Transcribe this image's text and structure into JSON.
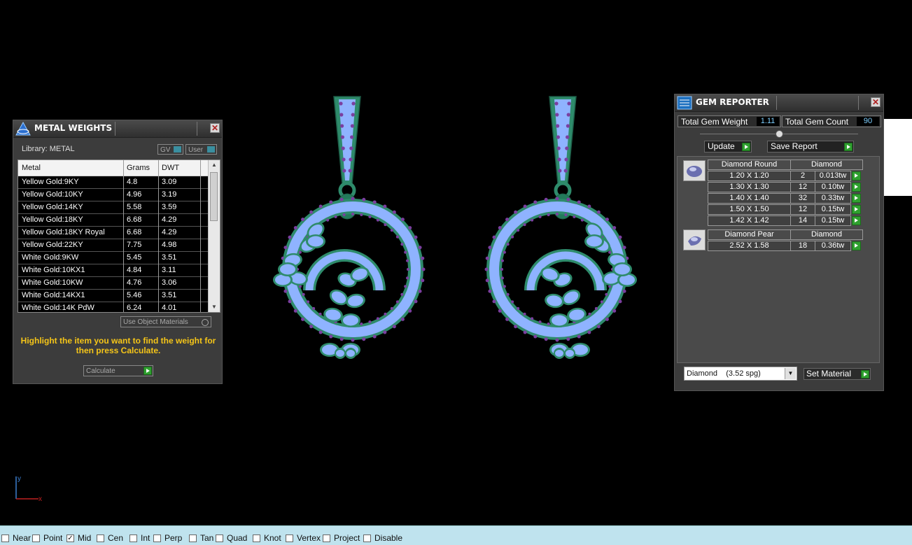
{
  "metal_weights": {
    "title": "METAL WEIGHTS",
    "library_label": "Library: METAL",
    "btn_gv": "GV",
    "btn_user": "User",
    "columns": [
      "Metal",
      "Grams",
      "DWT"
    ],
    "rows": [
      {
        "metal": "Yellow Gold:9KY",
        "grams": "4.8",
        "dwt": "3.09"
      },
      {
        "metal": "Yellow Gold:10KY",
        "grams": "4.96",
        "dwt": "3.19"
      },
      {
        "metal": "Yellow Gold:14KY",
        "grams": "5.58",
        "dwt": "3.59"
      },
      {
        "metal": "Yellow Gold:18KY",
        "grams": "6.68",
        "dwt": "4.29"
      },
      {
        "metal": "Yellow Gold:18KY Royal",
        "grams": "6.68",
        "dwt": "4.29"
      },
      {
        "metal": "Yellow Gold:22KY",
        "grams": "7.75",
        "dwt": "4.98"
      },
      {
        "metal": "White Gold:9KW",
        "grams": "5.45",
        "dwt": "3.51"
      },
      {
        "metal": "White Gold:10KX1",
        "grams": "4.84",
        "dwt": "3.11"
      },
      {
        "metal": "White Gold:10KW",
        "grams": "4.76",
        "dwt": "3.06"
      },
      {
        "metal": "White Gold:14KX1",
        "grams": "5.46",
        "dwt": "3.51"
      },
      {
        "metal": "White Gold:14K PdW",
        "grams": "6.24",
        "dwt": "4.01"
      }
    ],
    "use_object_materials": "Use Object Materials",
    "hint": "Highlight the item you want to find the weight for then press Calculate.",
    "calculate": "Calculate"
  },
  "gem_reporter": {
    "title": "GEM REPORTER",
    "total_weight_label": "Total Gem Weight",
    "total_weight_value": "1.11",
    "total_count_label": "Total Gem Count",
    "total_count_value": "90",
    "update": "Update",
    "save_report": "Save Report",
    "groups": [
      {
        "shape": "Diamond Round",
        "material": "Diamond",
        "rows": [
          {
            "size": "1.20 X 1.20",
            "count": "2",
            "weight": "0.013tw"
          },
          {
            "size": "1.30 X 1.30",
            "count": "12",
            "weight": "0.10tw"
          },
          {
            "size": "1.40 X 1.40",
            "count": "32",
            "weight": "0.33tw"
          },
          {
            "size": "1.50 X 1.50",
            "count": "12",
            "weight": "0.15tw"
          },
          {
            "size": "1.42 X 1.42",
            "count": "14",
            "weight": "0.15tw"
          }
        ]
      },
      {
        "shape": "Diamond Pear",
        "material": "Diamond",
        "rows": [
          {
            "size": "2.52 X 1.58",
            "count": "18",
            "weight": "0.36tw"
          }
        ]
      }
    ],
    "material_select": "Diamond    (3.52 spg)",
    "set_material": "Set Material"
  },
  "axis": {
    "x": "x",
    "y": "y"
  },
  "snaps": [
    {
      "label": "Near",
      "checked": false
    },
    {
      "label": "Point",
      "checked": false
    },
    {
      "label": "Mid",
      "checked": true
    },
    {
      "label": "Cen",
      "checked": false
    },
    {
      "label": "Int",
      "checked": false
    },
    {
      "label": "Perp",
      "checked": false
    },
    {
      "label": "Tan",
      "checked": false
    },
    {
      "label": "Quad",
      "checked": false
    },
    {
      "label": "Knot",
      "checked": false
    },
    {
      "label": "Vertex",
      "checked": false
    },
    {
      "label": "Project",
      "checked": false
    },
    {
      "label": "Disable",
      "checked": false
    }
  ],
  "colors": {
    "metal": "#2e8b6b",
    "gem_round": "#8fb3ff",
    "gem_accent": "#7b3fa0",
    "snapbar": "#bfe3ee",
    "hint": "#f5c518",
    "go": "#2fa02f"
  }
}
